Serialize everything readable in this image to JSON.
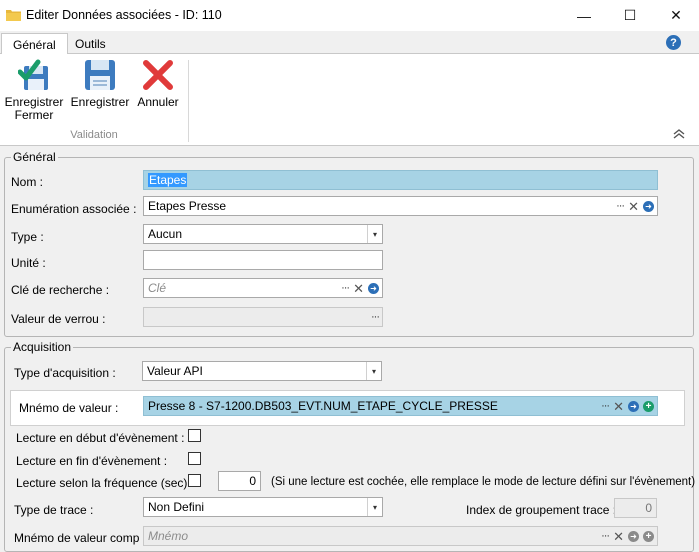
{
  "window": {
    "title": "Editer Données associées - ID: 110",
    "minimize": "—",
    "maximize": "☐",
    "close": "✕"
  },
  "tabs": [
    {
      "label": "Général",
      "active": true
    },
    {
      "label": "Outils",
      "active": false
    }
  ],
  "help": "?",
  "ribbon": {
    "save_close_line1": "Enregistrer",
    "save_close_line2": "Fermer",
    "save": "Enregistrer",
    "cancel": "Annuler",
    "group_label": "Validation"
  },
  "general": {
    "title": "Général",
    "nom_label": "Nom :",
    "nom_value": "Etapes",
    "enum_label": "Enumération associée :",
    "enum_value": "Etapes Presse",
    "type_label": "Type :",
    "type_value": "Aucun",
    "unite_label": "Unité :",
    "unite_value": "",
    "cle_label": "Clé de recherche :",
    "cle_placeholder": "Clé",
    "verrou_label": "Valeur de verrou :",
    "verrou_value": ""
  },
  "acquisition": {
    "title": "Acquisition",
    "type_acq_label": "Type d'acquisition :",
    "type_acq_value": "Valeur API",
    "mnemo_label": "Mnémo de valeur :",
    "mnemo_value": "Presse 8 - S7-1200.DB503_EVT.NUM_ETAPE_CYCLE_PRESSE",
    "lecture_debut_label": "Lecture en début d'évènement :",
    "lecture_fin_label": "Lecture en fin d'évènement :",
    "lecture_freq_label": "Lecture selon la fréquence (sec) :",
    "freq_value": "0",
    "freq_note": "(Si une lecture est cochée, elle remplace le mode de lecture défini sur l'évènement)",
    "type_trace_label": "Type de trace :",
    "type_trace_value": "Non Defini",
    "index_label": "Index de groupement trace :",
    "index_value": "0",
    "mnemo_comp_label": "Mnémo de valeur comp :",
    "mnemo_comp_placeholder": "Mnémo"
  },
  "glyphs": {
    "ellipsis": "···",
    "clear": "✕",
    "go": "➜",
    "plus": "+",
    "dropdown": "▾",
    "collapse": "︽"
  },
  "colors": {
    "accent": "#2c6fb7",
    "highlight": "#a7d3e5",
    "selection": "#3399ff",
    "cancel_red": "#e03a3a",
    "check_green": "#1a9c6a"
  }
}
